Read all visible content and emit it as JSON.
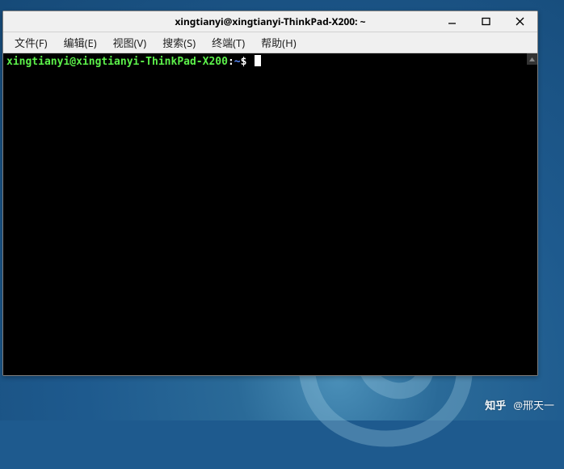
{
  "window": {
    "title": "xingtianyi@xingtianyi-ThinkPad-X200: ~"
  },
  "menubar": {
    "items": [
      {
        "label": "文件(F)"
      },
      {
        "label": "编辑(E)"
      },
      {
        "label": "视图(V)"
      },
      {
        "label": "搜索(S)"
      },
      {
        "label": "终端(T)"
      },
      {
        "label": "帮助(H)"
      }
    ]
  },
  "terminal": {
    "prompt_user_host": "xingtianyi@xingtianyi-ThinkPad-X200",
    "prompt_sep1": ":",
    "prompt_path": "~",
    "prompt_suffix": "$"
  },
  "watermark": {
    "logo": "知乎",
    "text": "@邢天一"
  }
}
